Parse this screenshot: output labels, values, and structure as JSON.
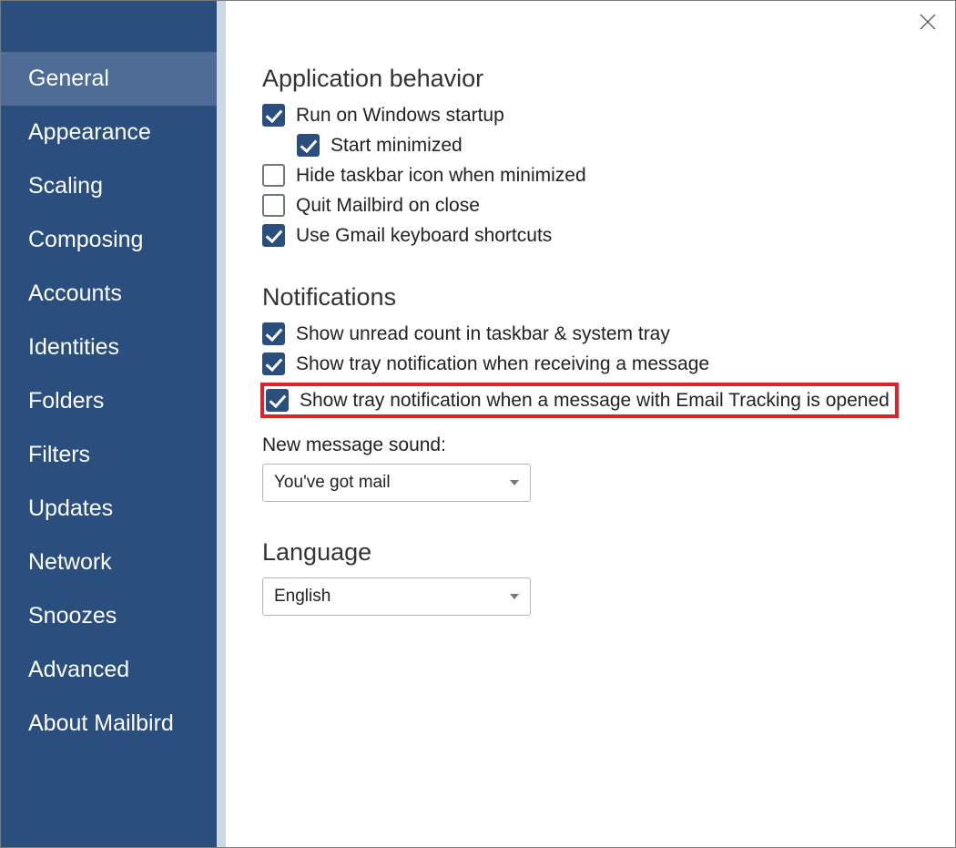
{
  "sidebar": {
    "items": [
      {
        "label": "General",
        "active": true
      },
      {
        "label": "Appearance",
        "active": false
      },
      {
        "label": "Scaling",
        "active": false
      },
      {
        "label": "Composing",
        "active": false
      },
      {
        "label": "Accounts",
        "active": false
      },
      {
        "label": "Identities",
        "active": false
      },
      {
        "label": "Folders",
        "active": false
      },
      {
        "label": "Filters",
        "active": false
      },
      {
        "label": "Updates",
        "active": false
      },
      {
        "label": "Network",
        "active": false
      },
      {
        "label": "Snoozes",
        "active": false
      },
      {
        "label": "Advanced",
        "active": false
      },
      {
        "label": "About Mailbird",
        "active": false
      }
    ]
  },
  "sections": {
    "app_behavior": {
      "title": "Application behavior",
      "run_startup": {
        "label": "Run on Windows startup",
        "checked": true,
        "indent": false
      },
      "start_minimized": {
        "label": "Start minimized",
        "checked": true,
        "indent": true
      },
      "hide_taskbar": {
        "label": "Hide taskbar icon when minimized",
        "checked": false,
        "indent": false
      },
      "quit_on_close": {
        "label": "Quit Mailbird on close",
        "checked": false,
        "indent": false
      },
      "gmail_shortcuts": {
        "label": "Use Gmail keyboard shortcuts",
        "checked": true,
        "indent": false
      }
    },
    "notifications": {
      "title": "Notifications",
      "unread_count": {
        "label": "Show unread count in taskbar & system tray",
        "checked": true
      },
      "tray_receive": {
        "label": "Show tray notification when receiving a message",
        "checked": true
      },
      "tray_tracking": {
        "label": "Show tray notification when a message with Email Tracking is opened",
        "checked": true
      },
      "sound_label": "New message sound:",
      "sound_value": "You've got mail"
    },
    "language": {
      "title": "Language",
      "value": "English"
    }
  }
}
